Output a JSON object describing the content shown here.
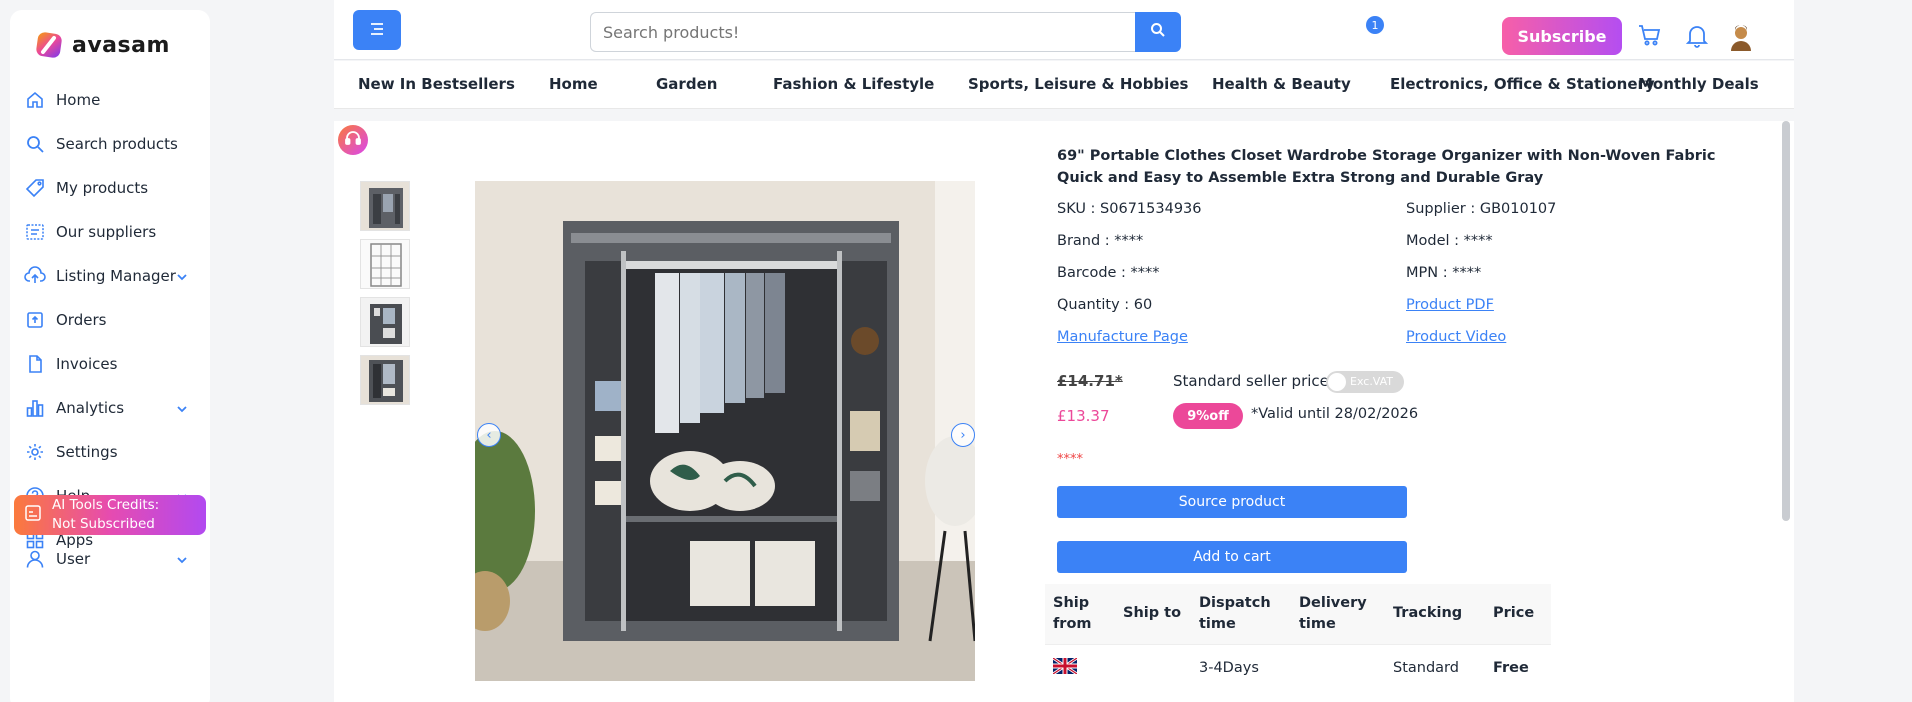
{
  "brand": {
    "name": "avasam"
  },
  "sidebar": {
    "items": [
      {
        "label": "Home",
        "icon": "home-icon"
      },
      {
        "label": "Search products",
        "icon": "search-icon"
      },
      {
        "label": "My products",
        "icon": "tag-icon"
      },
      {
        "label": "Our suppliers",
        "icon": "supplier-icon"
      },
      {
        "label": "Listing Manager",
        "icon": "cloud-upload-icon",
        "expandable": true
      },
      {
        "label": "Orders",
        "icon": "orders-icon"
      },
      {
        "label": "Invoices",
        "icon": "document-icon"
      },
      {
        "label": "Analytics",
        "icon": "bar-chart-icon",
        "expandable": true
      },
      {
        "label": "Settings",
        "icon": "gear-icon"
      },
      {
        "label": "Help",
        "icon": "help-icon",
        "expandable": true
      },
      {
        "label": "Apps",
        "icon": "apps-grid-icon"
      }
    ],
    "ai_credits": {
      "line1": "AI Tools Credits:",
      "line2": "Not Subscribed"
    },
    "user": {
      "label": "User"
    }
  },
  "header": {
    "search_placeholder": "Search products!",
    "subscribe_label": "Subscribe",
    "notification_count": "1"
  },
  "categories": [
    "New In Bestsellers",
    "Home",
    "Garden",
    "Fashion & Lifestyle",
    "Sports, Leisure & Hobbies",
    "Health & Beauty",
    "Electronics, Office & Stationery",
    "Monthly Deals"
  ],
  "product": {
    "title": "69\" Portable Clothes Closet Wardrobe Storage Organizer with Non-Woven Fabric Quick and Easy to Assemble Extra Strong and Durable Gray",
    "sku": "SKU : S0671534936",
    "supplier": "Supplier : GB010107",
    "brand": "Brand : ****",
    "model": "Model : ****",
    "barcode": "Barcode : ****",
    "mpn": "MPN : ****",
    "quantity": "Quantity : 60",
    "product_pdf": "Product PDF",
    "manufacture_page": "Manufacture Page",
    "product_video": "Product Video",
    "old_price": "£14.71*",
    "standard_label": "Standard seller price",
    "vat_toggle": "Exc.VAT",
    "new_price": "£13.37",
    "discount": "9%off",
    "valid_until": "*Valid until 28/02/2026",
    "stars": "****",
    "source_button": "Source product",
    "cart_button": "Add to cart"
  },
  "shipping": {
    "headers": [
      "Ship from",
      "Ship to",
      "Dispatch time",
      "Delivery time",
      "Tracking",
      "Price"
    ],
    "rows": [
      {
        "from_flag": "uk-flag-icon",
        "to": "",
        "dispatch": "3-4Days",
        "delivery": "",
        "tracking": "Standard",
        "price": "Free"
      }
    ]
  },
  "colors": {
    "accent": "#3b82f6",
    "pink": "#ec4899",
    "free_green": "#16a34a"
  }
}
